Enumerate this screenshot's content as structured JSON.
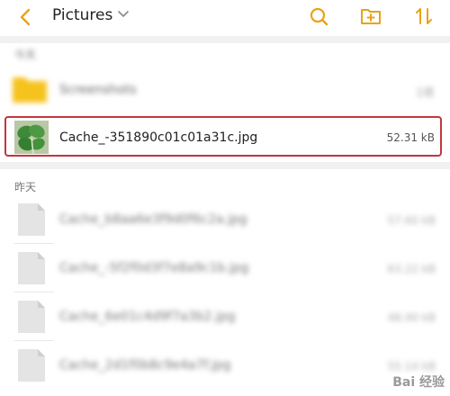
{
  "header": {
    "title": "Pictures"
  },
  "today_group": {
    "label": "今天",
    "folder": {
      "name": "Screenshots",
      "meta": "1项"
    }
  },
  "selected_file": {
    "name": "Cache_-351890c01c01a31c.jpg",
    "size": "52.31 kB"
  },
  "yesterday_group": {
    "label": "昨天",
    "files": [
      {
        "name": "Cache_b8aa6e3f9d0f6c2a.jpg",
        "size": "57.60 kB"
      },
      {
        "name": "Cache_-5f2f0d3f7e8a9c1b.jpg",
        "size": "63.22 kB"
      },
      {
        "name": "Cache_6e01c4d9f7a3b2.jpg",
        "size": "48.90 kB"
      },
      {
        "name": "Cache_2d1f0b8c9e4a7f.jpg",
        "size": "55.14 kB"
      }
    ]
  },
  "watermark": "Bai 经验",
  "colors": {
    "accent": "#e8a317",
    "highlight": "#c2363e"
  }
}
